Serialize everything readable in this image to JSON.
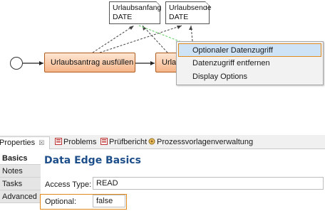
{
  "diagram": {
    "data_objects": [
      {
        "name": "Urlaubsanfang",
        "type": "DATE"
      },
      {
        "name": "Urlaubsende",
        "type": "DATE"
      }
    ],
    "tasks": [
      {
        "label": "Urlaubsantrag ausfüllen"
      },
      {
        "label": "Urla"
      }
    ]
  },
  "context_menu": {
    "items": [
      {
        "label": "Optionaler Datenzugriff",
        "selected": true
      },
      {
        "label": "Datenzugriff entfernen",
        "selected": false
      },
      {
        "label": "Display Options",
        "selected": false
      }
    ]
  },
  "view_tabs": [
    {
      "label": "Properties",
      "close": "☒",
      "active": true
    },
    {
      "label": "Problems",
      "active": false
    },
    {
      "label": "Prüfbericht",
      "active": false
    },
    {
      "label": "Prozessvorlagenverwaltung",
      "active": false
    }
  ],
  "side_tabs": [
    {
      "label": "Basics",
      "active": true
    },
    {
      "label": "Notes",
      "active": false
    },
    {
      "label": "Tasks",
      "active": false
    },
    {
      "label": "Advanced",
      "active": false
    }
  ],
  "section": {
    "title": "Data Edge Basics",
    "access_type_label": "Access Type:",
    "access_type_value": "READ",
    "optional_label": "Optional:",
    "optional_value": "false"
  },
  "colors": {
    "task_fill": "#f6b68a",
    "task_border": "#b05a1c",
    "highlight": "#e08a1e",
    "menu_selected": "#cfe3f7",
    "section_title": "#1e4f8a",
    "optional_edge": "#5fcf5f"
  }
}
